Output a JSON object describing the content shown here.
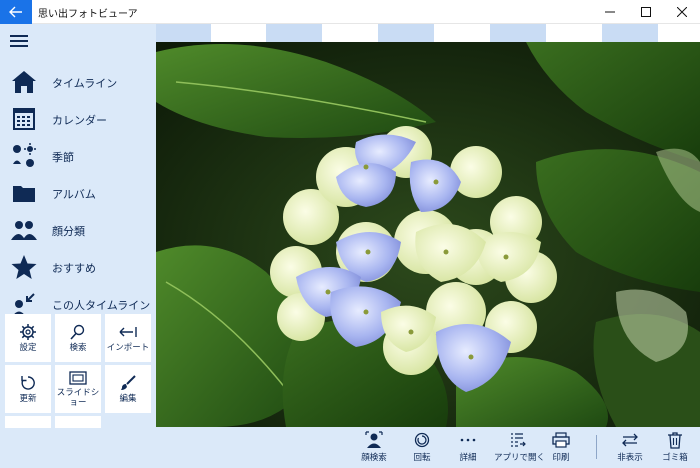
{
  "app": {
    "title": "思い出フォトビューア"
  },
  "sidebar": {
    "items": [
      {
        "label": "タイムライン",
        "icon": "house-icon"
      },
      {
        "label": "カレンダー",
        "icon": "calendar-icon"
      },
      {
        "label": "季節",
        "icon": "season-icon"
      },
      {
        "label": "アルバム",
        "icon": "folder-icon"
      },
      {
        "label": "顔分類",
        "icon": "faces-icon"
      },
      {
        "label": "おすすめ",
        "icon": "star-icon"
      },
      {
        "label": "この人タイムライン",
        "icon": "person-timeline-icon"
      }
    ],
    "tiles": [
      {
        "label": "設定",
        "icon": "gear-icon"
      },
      {
        "label": "検索",
        "icon": "search-icon"
      },
      {
        "label": "インポート",
        "icon": "import-icon"
      },
      {
        "label": "更新",
        "icon": "refresh-icon"
      },
      {
        "label": "スライドショー",
        "icon": "slideshow-icon"
      },
      {
        "label": "編集",
        "icon": "brush-icon"
      }
    ]
  },
  "toolbar": {
    "face_search": "顔検索",
    "rotate": "回転",
    "details": "詳細",
    "open_with": "アプリで開く",
    "print": "印刷",
    "hide": "非表示",
    "trash": "ゴミ箱"
  },
  "colors": {
    "accent": "#1a73e8",
    "sidebar_bg": "#dbe9f9",
    "icon_navy": "#0f2a55",
    "filmstrip": "#c9dcf4"
  }
}
